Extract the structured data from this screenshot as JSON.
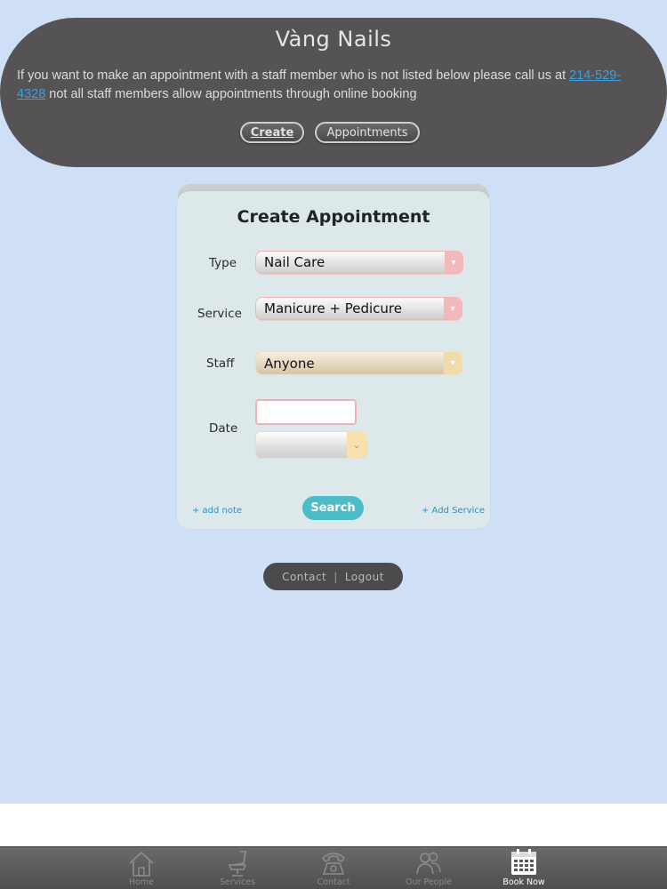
{
  "header": {
    "title": "Vàng Nails",
    "message_before": "If you want to make an appointment with a staff member who is not listed below please call us at ",
    "phone": "214-529-4328",
    "message_after": " not all staff members allow appointments through online booking",
    "create_label": "Create",
    "appointments_label": "Appointments"
  },
  "form": {
    "title": "Create Appointment",
    "type_label": "Type",
    "type_value": "Nail Care",
    "service_label": "Service",
    "service_value": "Manicure + Pedicure",
    "staff_label": "Staff",
    "staff_value": "Anyone",
    "date_label": "Date",
    "date_value": "",
    "add_note_label": "+ add note",
    "search_label": "Search",
    "add_service_label": "+ Add Service"
  },
  "footer": {
    "contact_label": "Contact",
    "separator": "|",
    "logout_label": "Logout"
  },
  "tabbar": {
    "items": [
      {
        "label": "Home",
        "icon": "home-icon"
      },
      {
        "label": "Services",
        "icon": "chair-icon"
      },
      {
        "label": "Contact",
        "icon": "phone-icon"
      },
      {
        "label": "Our People",
        "icon": "people-icon"
      },
      {
        "label": "Book Now",
        "icon": "calendar-icon",
        "active": true
      }
    ]
  },
  "colors": {
    "background": "#cfdff5",
    "header": "#555354",
    "card": "#dde8ea",
    "accent": "#4dbcc9",
    "link": "#3aa0e0"
  }
}
